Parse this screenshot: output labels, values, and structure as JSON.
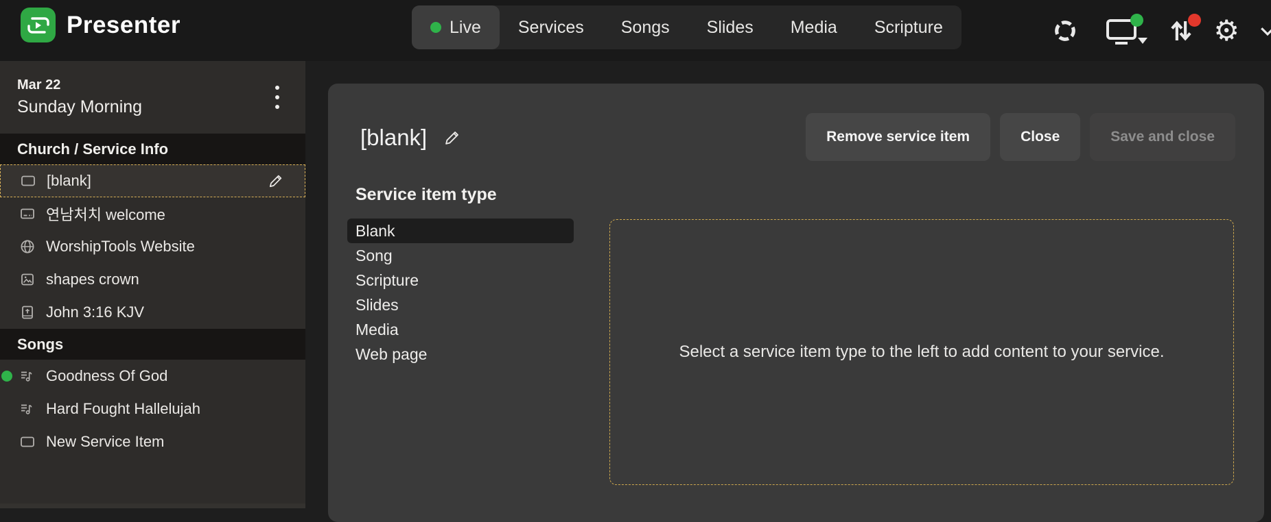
{
  "app": {
    "name": "Presenter"
  },
  "topbar": {
    "tabs": [
      {
        "label": "Live",
        "active": true,
        "has_dot": true
      },
      {
        "label": "Services",
        "active": false
      },
      {
        "label": "Songs",
        "active": false
      },
      {
        "label": "Slides",
        "active": false
      },
      {
        "label": "Media",
        "active": false
      },
      {
        "label": "Scripture",
        "active": false
      }
    ],
    "icons": [
      {
        "name": "sync-circle-icon"
      },
      {
        "name": "display-output-icon",
        "badge": "green"
      },
      {
        "name": "transfer-arrows-icon",
        "badge": "red"
      },
      {
        "name": "settings-gear-icon"
      },
      {
        "name": "chevron-down-icon"
      }
    ]
  },
  "sidebar": {
    "service_date": "Mar 22",
    "service_title": "Sunday Morning",
    "sections": [
      {
        "header": "Church / Service Info",
        "items": [
          {
            "label": "[blank]",
            "icon": "blank-slide-icon",
            "selected": true,
            "editable": true
          },
          {
            "label": "연남처치 welcome",
            "icon": "slides-icon"
          },
          {
            "label": "WorshipTools Website",
            "icon": "globe-icon"
          },
          {
            "label": "shapes crown",
            "icon": "image-icon"
          },
          {
            "label": "John 3:16 KJV",
            "icon": "bible-icon"
          }
        ]
      },
      {
        "header": "Songs",
        "items": [
          {
            "label": "Goodness Of God",
            "icon": "music-list-icon",
            "live": true
          },
          {
            "label": "Hard Fought Hallelujah",
            "icon": "music-list-icon"
          },
          {
            "label": "New Service Item",
            "icon": "blank-slide-icon"
          }
        ]
      }
    ]
  },
  "editor": {
    "title": "[blank]",
    "buttons": {
      "remove": "Remove service item",
      "close": "Close",
      "save": "Save and close",
      "save_disabled": true
    },
    "type_heading": "Service item type",
    "types": [
      "Blank",
      "Song",
      "Scripture",
      "Slides",
      "Media",
      "Web page"
    ],
    "selected_type": "Blank",
    "placeholder": "Select a service item type to the left to add content to your service."
  },
  "colors": {
    "accent_green": "#2fb34a",
    "badge_red": "#e2382c",
    "selection_dashed": "#d9b157",
    "card_bg": "#3a3a3a",
    "sidebar_bg": "#2e2c2a",
    "topbar_bg": "#191919"
  }
}
